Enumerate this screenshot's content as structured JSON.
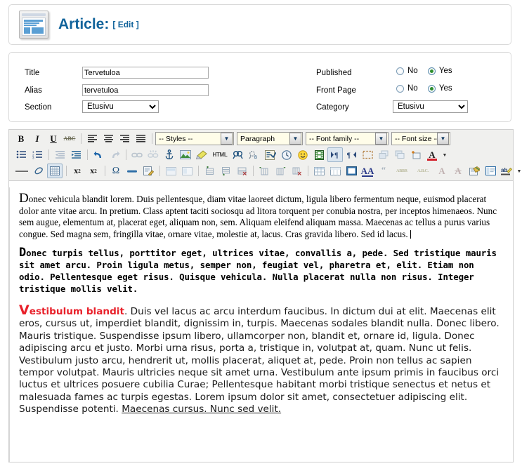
{
  "header": {
    "icon": "article-page-icon",
    "title": "Article:",
    "edit_label": "[ Edit ]"
  },
  "form": {
    "left": {
      "title_label": "Title",
      "title_value": "Tervetuloa",
      "alias_label": "Alias",
      "alias_value": "tervetuloa",
      "section_label": "Section",
      "section_value": "Etusivu",
      "section_options": [
        "Etusivu"
      ]
    },
    "right": {
      "published_label": "Published",
      "published_no": "No",
      "published_yes": "Yes",
      "published_selected": "Yes",
      "frontpage_label": "Front Page",
      "frontpage_no": "No",
      "frontpage_yes": "Yes",
      "frontpage_selected": "Yes",
      "category_label": "Category",
      "category_value": "Etusivu",
      "category_options": [
        "Etusivu"
      ]
    }
  },
  "editor": {
    "toolbar_row1": {
      "bold": "B",
      "italic": "I",
      "underline": "U",
      "strikethrough": "ABC",
      "align_left": "align-left-icon",
      "align_center": "align-center-icon",
      "align_right": "align-right-icon",
      "align_justify": "align-justify-icon",
      "styles_label": "-- Styles --",
      "paragraph_label": "Paragraph",
      "fontfamily_label": "-- Font family --",
      "fontsize_label": "-- Font size --"
    },
    "toolbar_row2": {
      "bullet_list": "unordered-list-icon",
      "numbered_list": "ordered-list-icon",
      "outdent": "outdent-icon",
      "indent": "indent-icon",
      "undo": "undo-icon",
      "redo": "redo-icon",
      "link": "link-icon",
      "unlink": "unlink-icon",
      "anchor": "anchor-icon",
      "image": "image-icon",
      "cleanup": "cleanup-icon",
      "html_label": "HTML",
      "find": "find-icon",
      "find_replace": "find-replace-icon",
      "spellcheck": "spellcheck-icon",
      "insert_date": "clock-icon",
      "emoticon": "smiley-icon",
      "media": "media-icon",
      "ltr": "direction-ltr-icon",
      "rtl": "direction-rtl-icon",
      "visual_aid": "visual-aid-icon",
      "layer_forward": "layer-forward-icon",
      "layer_back": "layer-back-icon",
      "insert_layer": "insert-layer-icon",
      "text_color": "A",
      "color_arrow": "chevron-down-icon"
    },
    "toolbar_row3": {
      "horizontal_rule": "horizontal-rule-icon",
      "remove_format": "eraser-icon",
      "toggle_guides": "toggle-guides-icon",
      "subscript": "x",
      "subscript_sub": "2",
      "superscript": "x",
      "superscript_sup": "2",
      "charmap": "Ω",
      "page_break": "page-break-icon",
      "edit_css": "edit-css-icon",
      "cell_props": "cell-properties-icon",
      "merge_cells": "merge-cells-icon",
      "row_props": "row-properties-icon",
      "row_before": "row-before-icon",
      "row_after": "row-after-icon",
      "delete_row": "delete-row-icon",
      "col_before": "column-before-icon",
      "col_after": "column-after-icon",
      "delete_col": "delete-column-icon",
      "insert_table": "insert-table-icon",
      "table_props": "table-properties-icon",
      "fullscreen": "fullscreen-icon",
      "styleprops": "AA",
      "blockquote": "“",
      "abbr": "ABBR",
      "acronym": "A.B.C.",
      "ins": "A",
      "del": "A",
      "attributes": "attributes-icon",
      "template": "template-icon",
      "spellcheck2": "spellcheck-ab-icon",
      "spell_arrow": "chevron-down-icon"
    },
    "body": {
      "p1_cap": "D",
      "p1": "onec vehicula blandit lorem. Duis pellentesque, diam vitae laoreet dictum, ligula libero fermentum neque, euismod placerat dolor ante vitae arcu. In pretium. Class aptent taciti sociosqu ad litora torquent per conubia nostra, per inceptos himenaeos. Nunc sem augue, elementum at, placerat eget, aliquam non, sem. Aliquam eleifend aliquam massa. Maecenas ac tellus a purus varius congue. Sed magna sem, fringilla vitae, ornare vitae, molestie at, lacus. Cras gravida libero. Sed id lacus.",
      "p2_cap": "D",
      "p2": "onec turpis tellus, porttitor eget, ultrices vitae, convallis a, pede. Sed tristique mauris sit amet arcu. Proin ligula metus, semper non, feugiat vel, pharetra et, elit. Etiam non odio. Pellentesque eget risus. Quisque vehicula. Nulla placerat nulla non risus. Integer tristique mollis velit.",
      "p3_cap": "V",
      "p3_red": "estibulum blandit",
      "p3_rest": ". Duis vel lacus ac arcu interdum faucibus. In dictum dui at elit. Maecenas elit eros, cursus ut, imperdiet blandit, dignissim in, turpis. Maecenas sodales blandit nulla. Donec libero. Mauris tristique. Suspendisse ipsum libero, ullamcorper non, blandit et, ornare id, ligula. Donec adipiscing arcu et justo. Morbi urna risus, porta a, tristique in, volutpat at, quam. Nunc ut felis. Vestibulum justo arcu, hendrerit ut, mollis placerat, aliquet at, pede. Proin non tellus ac sapien tempor volutpat. Mauris ultricies neque sit amet urna. Vestibulum ante ipsum primis in faucibus orci luctus et ultrices posuere cubilia Curae; Pellentesque habitant morbi tristique senectus et netus et malesuada fames ac turpis egestas. Lorem ipsum dolor sit amet, consectetuer adipiscing elit. Suspendisse potenti. ",
      "p3_underlined": "Maecenas cursus. Nunc sed velit."
    }
  },
  "colors": {
    "title_blue": "#11639b",
    "red_text": "#e8202a",
    "dropdown_bg": "#fffde9",
    "toolbar_bg": "#f0f0ee",
    "panel_border": "#d9d9d9"
  }
}
